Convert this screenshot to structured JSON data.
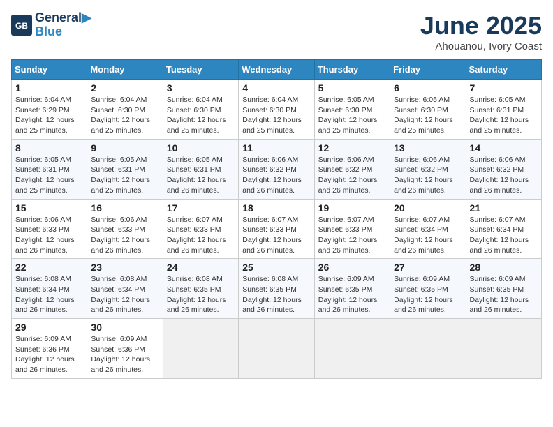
{
  "header": {
    "logo_line1": "General",
    "logo_line2": "Blue",
    "month": "June 2025",
    "location": "Ahouanou, Ivory Coast"
  },
  "weekdays": [
    "Sunday",
    "Monday",
    "Tuesday",
    "Wednesday",
    "Thursday",
    "Friday",
    "Saturday"
  ],
  "weeks": [
    [
      {
        "day": "1",
        "info": "Sunrise: 6:04 AM\nSunset: 6:29 PM\nDaylight: 12 hours\nand 25 minutes."
      },
      {
        "day": "2",
        "info": "Sunrise: 6:04 AM\nSunset: 6:30 PM\nDaylight: 12 hours\nand 25 minutes."
      },
      {
        "day": "3",
        "info": "Sunrise: 6:04 AM\nSunset: 6:30 PM\nDaylight: 12 hours\nand 25 minutes."
      },
      {
        "day": "4",
        "info": "Sunrise: 6:04 AM\nSunset: 6:30 PM\nDaylight: 12 hours\nand 25 minutes."
      },
      {
        "day": "5",
        "info": "Sunrise: 6:05 AM\nSunset: 6:30 PM\nDaylight: 12 hours\nand 25 minutes."
      },
      {
        "day": "6",
        "info": "Sunrise: 6:05 AM\nSunset: 6:30 PM\nDaylight: 12 hours\nand 25 minutes."
      },
      {
        "day": "7",
        "info": "Sunrise: 6:05 AM\nSunset: 6:31 PM\nDaylight: 12 hours\nand 25 minutes."
      }
    ],
    [
      {
        "day": "8",
        "info": "Sunrise: 6:05 AM\nSunset: 6:31 PM\nDaylight: 12 hours\nand 25 minutes."
      },
      {
        "day": "9",
        "info": "Sunrise: 6:05 AM\nSunset: 6:31 PM\nDaylight: 12 hours\nand 25 minutes."
      },
      {
        "day": "10",
        "info": "Sunrise: 6:05 AM\nSunset: 6:31 PM\nDaylight: 12 hours\nand 26 minutes."
      },
      {
        "day": "11",
        "info": "Sunrise: 6:06 AM\nSunset: 6:32 PM\nDaylight: 12 hours\nand 26 minutes."
      },
      {
        "day": "12",
        "info": "Sunrise: 6:06 AM\nSunset: 6:32 PM\nDaylight: 12 hours\nand 26 minutes."
      },
      {
        "day": "13",
        "info": "Sunrise: 6:06 AM\nSunset: 6:32 PM\nDaylight: 12 hours\nand 26 minutes."
      },
      {
        "day": "14",
        "info": "Sunrise: 6:06 AM\nSunset: 6:32 PM\nDaylight: 12 hours\nand 26 minutes."
      }
    ],
    [
      {
        "day": "15",
        "info": "Sunrise: 6:06 AM\nSunset: 6:33 PM\nDaylight: 12 hours\nand 26 minutes."
      },
      {
        "day": "16",
        "info": "Sunrise: 6:06 AM\nSunset: 6:33 PM\nDaylight: 12 hours\nand 26 minutes."
      },
      {
        "day": "17",
        "info": "Sunrise: 6:07 AM\nSunset: 6:33 PM\nDaylight: 12 hours\nand 26 minutes."
      },
      {
        "day": "18",
        "info": "Sunrise: 6:07 AM\nSunset: 6:33 PM\nDaylight: 12 hours\nand 26 minutes."
      },
      {
        "day": "19",
        "info": "Sunrise: 6:07 AM\nSunset: 6:33 PM\nDaylight: 12 hours\nand 26 minutes."
      },
      {
        "day": "20",
        "info": "Sunrise: 6:07 AM\nSunset: 6:34 PM\nDaylight: 12 hours\nand 26 minutes."
      },
      {
        "day": "21",
        "info": "Sunrise: 6:07 AM\nSunset: 6:34 PM\nDaylight: 12 hours\nand 26 minutes."
      }
    ],
    [
      {
        "day": "22",
        "info": "Sunrise: 6:08 AM\nSunset: 6:34 PM\nDaylight: 12 hours\nand 26 minutes."
      },
      {
        "day": "23",
        "info": "Sunrise: 6:08 AM\nSunset: 6:34 PM\nDaylight: 12 hours\nand 26 minutes."
      },
      {
        "day": "24",
        "info": "Sunrise: 6:08 AM\nSunset: 6:35 PM\nDaylight: 12 hours\nand 26 minutes."
      },
      {
        "day": "25",
        "info": "Sunrise: 6:08 AM\nSunset: 6:35 PM\nDaylight: 12 hours\nand 26 minutes."
      },
      {
        "day": "26",
        "info": "Sunrise: 6:09 AM\nSunset: 6:35 PM\nDaylight: 12 hours\nand 26 minutes."
      },
      {
        "day": "27",
        "info": "Sunrise: 6:09 AM\nSunset: 6:35 PM\nDaylight: 12 hours\nand 26 minutes."
      },
      {
        "day": "28",
        "info": "Sunrise: 6:09 AM\nSunset: 6:35 PM\nDaylight: 12 hours\nand 26 minutes."
      }
    ],
    [
      {
        "day": "29",
        "info": "Sunrise: 6:09 AM\nSunset: 6:36 PM\nDaylight: 12 hours\nand 26 minutes."
      },
      {
        "day": "30",
        "info": "Sunrise: 6:09 AM\nSunset: 6:36 PM\nDaylight: 12 hours\nand 26 minutes."
      },
      {
        "day": "",
        "info": ""
      },
      {
        "day": "",
        "info": ""
      },
      {
        "day": "",
        "info": ""
      },
      {
        "day": "",
        "info": ""
      },
      {
        "day": "",
        "info": ""
      }
    ]
  ]
}
